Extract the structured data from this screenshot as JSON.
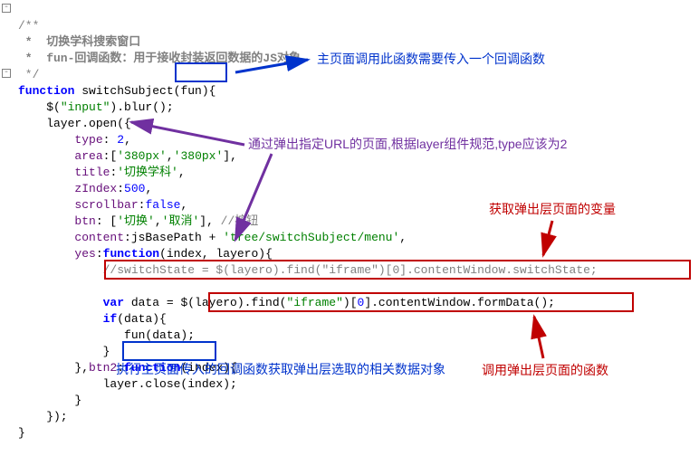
{
  "doc": {
    "open": "/**",
    "l1": " *  切换学科搜索窗口",
    "l2": " *  fun-回调函数：用于接收封装返回数据的JS对象",
    "l3": " */"
  },
  "code": {
    "fn_kw": "function",
    "fn_name": " switchSubject(fun){",
    "blur": "    $(\"input\").blur();",
    "layer_open": "    layer.open({",
    "type_key": "        type",
    "type_val": ": 2,",
    "area_key": "        area",
    "area_val": ":['380px','380px'],",
    "title_key": "        title",
    "title_val": ":'切换学科',",
    "zindex_key": "        zIndex",
    "zindex_val": ":500,",
    "scrollbar_key": "        scrollbar",
    "scrollbar_val": ":false,",
    "btn_key": "        btn",
    "btn_val": ": ['切换','取消'], ",
    "btn_cmt": "//按钮",
    "content_key": "        content",
    "content_val": ":jsBasePath + 'tree/switchSubject/menu',",
    "yes_key": "        yes",
    "yes_val": ":function(index, layero){",
    "switchstate": "            //switchState = $(layero).find(\"iframe\")[0].contentWindow.switchState;",
    "blank": "",
    "var_data": "            var data = $(layero).find(\"iframe\")[0].contentWindow.formData();",
    "if_data": "            if(data){",
    "fun_data": "               fun(data);",
    "close_if": "            }",
    "btn2_key": "        },btn2",
    "btn2_val": ":function(index){",
    "layer_close": "            layer.close(index);",
    "close_btn2": "        }",
    "close_open": "    });",
    "close_fn": "}"
  },
  "ann": {
    "a1": "主页面调用此函数需要传入一个回调函数",
    "a2": "通过弹出指定URL的页面,根据layer组件规范,type应该为2",
    "a3": "获取弹出层页面的变量",
    "a4": "执行主页面传入的回调函数获取弹出层选取的相关数据对象",
    "a5": "调用弹出层页面的函数"
  }
}
